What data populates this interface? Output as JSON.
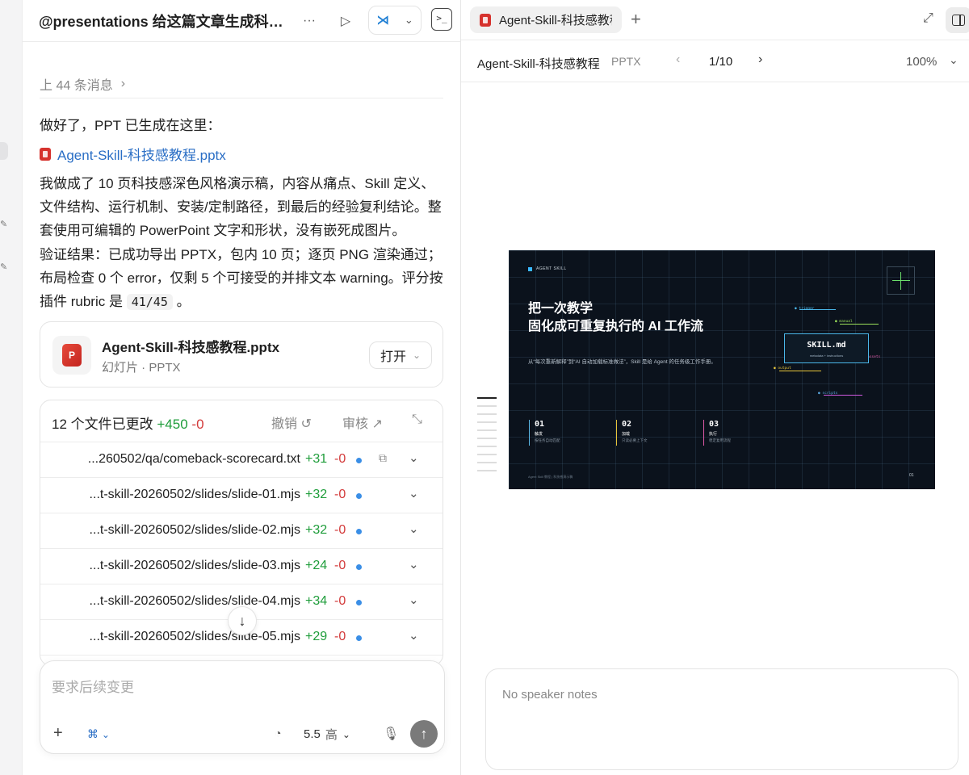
{
  "chat": {
    "title": "@presentations 给这篇文章生成科技...",
    "prev_messages": "上 44 条消息",
    "intro": "做好了，PPT 已生成在这里：",
    "file_link": "Agent-Skill-科技感教程.pptx",
    "para1": "我做成了 10 页科技感深色风格演示稿，内容从痛点、Skill 定义、文件结构、运行机制、安装/定制路径，到最后的经验复利结论。整套使用可编辑的 PowerPoint 文字和形状，没有嵌死成图片。",
    "para2_prefix": "验证结果：已成功导出 PPTX，包内 10 页；逐页 PNG 渲染通过；布局检查 0 个 error，仅剩 5 个可接受的并排文本 warning。评分按插件 rubric 是",
    "para2_code": "41/45",
    "para2_suffix": "。"
  },
  "file_card": {
    "name": "Agent-Skill-科技感教程.pptx",
    "sub": "幻灯片 · PPTX",
    "open_label": "打开"
  },
  "changes": {
    "summary": "12 个文件已更改",
    "added": "+450",
    "removed": "-0",
    "undo_label": "撤销",
    "review_label": "审核",
    "rows": [
      {
        "path": "...260502/qa/comeback-scorecard.txt",
        "add": "+31",
        "del": "-0"
      },
      {
        "path": "...t-skill-20260502/slides/slide-01.mjs",
        "add": "+32",
        "del": "-0"
      },
      {
        "path": "...t-skill-20260502/slides/slide-02.mjs",
        "add": "+32",
        "del": "-0"
      },
      {
        "path": "...t-skill-20260502/slides/slide-03.mjs",
        "add": "+24",
        "del": "-0"
      },
      {
        "path": "...t-skill-20260502/slides/slide-04.mjs",
        "add": "+34",
        "del": "-0"
      },
      {
        "path": "...t-skill-20260502/slides/slide-05.mjs",
        "add": "+29",
        "del": "-0"
      }
    ]
  },
  "composer": {
    "placeholder": "要求后续变更",
    "model_version": "5.5",
    "effort": "高"
  },
  "preview": {
    "tab_label": "Agent-Skill-科技感教程",
    "doc_title": "Agent-Skill-科技感教程",
    "doc_type": "PPTX",
    "page_indicator": "1/10",
    "zoom": "100%",
    "notes": "No speaker notes"
  },
  "slide": {
    "tag": "AGENT SKILL",
    "title_line1": "把一次教学",
    "title_line2": "固化成可重复执行的 AI 工作流",
    "subtitle": "从“每次重新解释”到“AI 自动加载标准做法”，Skill 是给 Agent 的任务级工作手册。",
    "box_title": "SKILL.md",
    "box_meta": "metadata + instructions",
    "nodes": {
      "trigger": "trigger",
      "manual": "manual",
      "assets": "assets",
      "output": "output",
      "scripts": "scripts"
    },
    "steps": [
      {
        "num": "01",
        "key": "触发",
        "desc": "按任务自动匹配"
      },
      {
        "num": "02",
        "key": "加载",
        "desc": "只读必要上下文"
      },
      {
        "num": "03",
        "key": "执行",
        "desc": "稳定复用流程"
      }
    ],
    "footer": "Agent Skill 教程 | 科技感演示稿",
    "page": "01"
  }
}
